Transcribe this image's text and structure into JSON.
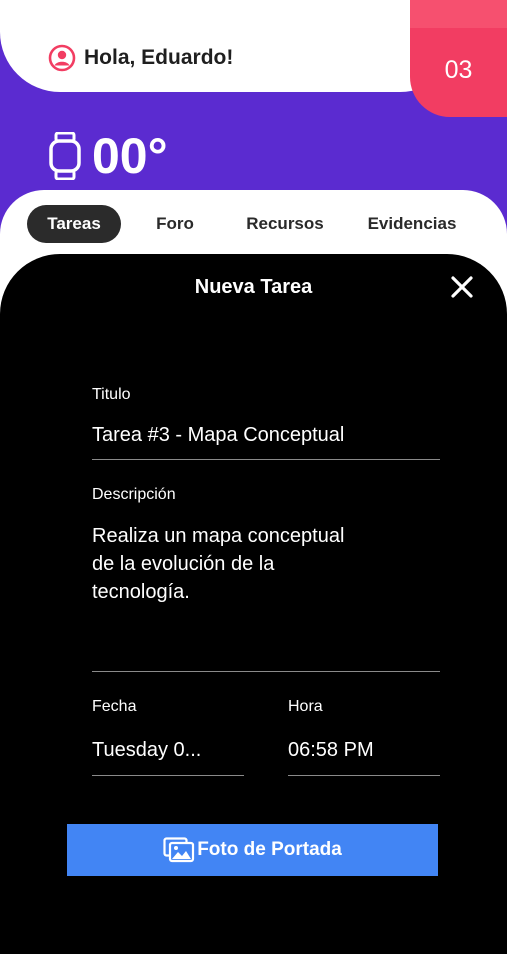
{
  "header": {
    "greeting": "Hola, Eduardo!",
    "counter": "03",
    "watch_value": "00°"
  },
  "tabs": [
    {
      "label": "Tareas",
      "active": true
    },
    {
      "label": "Foro",
      "active": false
    },
    {
      "label": "Recursos",
      "active": false
    },
    {
      "label": "Evidencias",
      "active": false
    }
  ],
  "modal": {
    "title": "Nueva Tarea",
    "titulo_label": "Titulo",
    "titulo_value": "Tarea #3 - Mapa Conceptual",
    "descripcion_label": "Descripción",
    "descripcion_value": "Realiza un mapa conceptual\nde la evolución de la\ntecnología.",
    "fecha_label": "Fecha",
    "fecha_value": "Tuesday 0...",
    "hora_label": "Hora",
    "hora_value": "06:58 PM",
    "cover_button_label": "Foto de Portada"
  },
  "icons": {
    "user": "user-circle-icon",
    "watch": "smartwatch-icon",
    "close": "close-icon",
    "photo": "photo-gallery-icon"
  },
  "colors": {
    "purple": "#5b2bd0",
    "pink": "#f23d62",
    "blue_button": "#4285f4",
    "modal_bg": "#000000"
  }
}
